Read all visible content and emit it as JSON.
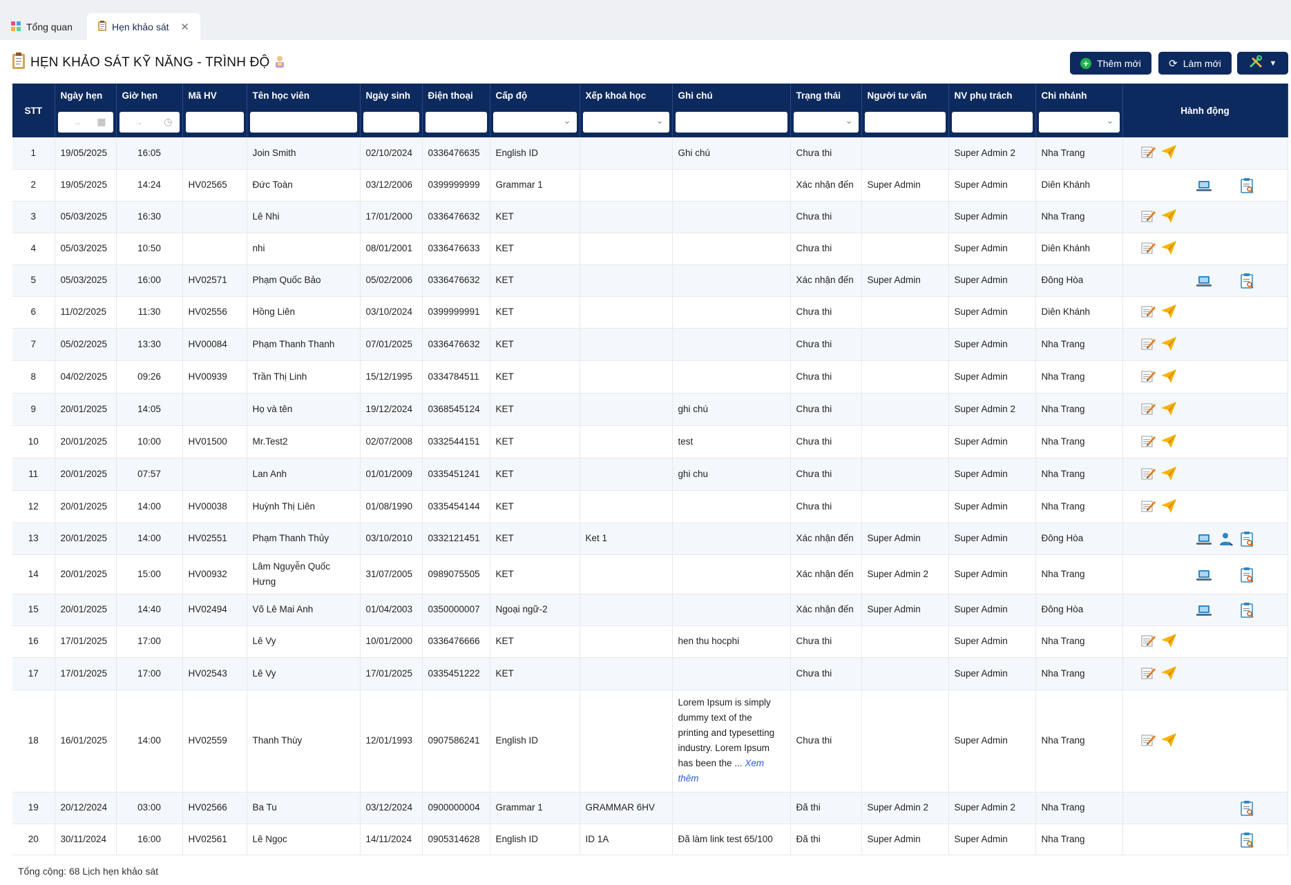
{
  "tabs": [
    {
      "label": "Tổng quan",
      "icon": "dashboard-icon"
    },
    {
      "label": "Hẹn khảo sát",
      "icon": "clipboard-icon",
      "active": true
    }
  ],
  "page": {
    "title": "HẸN KHẢO SÁT KỸ NĂNG - TRÌNH ĐỘ"
  },
  "toolbar": {
    "add_label": "Thêm mới",
    "refresh_label": "Làm mới"
  },
  "columns": [
    "STT",
    "Ngày hẹn",
    "Giờ hẹn",
    "Mã HV",
    "Tên học viên",
    "Ngày sinh",
    "Điện thoại",
    "Cấp độ",
    "Xếp khoá học",
    "Ghi chú",
    "Trạng thái",
    "Người tư vấn",
    "NV phụ trách",
    "Chi nhánh",
    "Hành động"
  ],
  "rows": [
    {
      "stt": "1",
      "date": "19/05/2025",
      "time": "16:05",
      "code": "",
      "name": "Join Smith",
      "dob": "02/10/2024",
      "phone": "0336476635",
      "level": "English ID",
      "course": "",
      "note": "Ghi chú",
      "status": "Chưa thi",
      "advisor": "",
      "staff": "Super Admin 2",
      "branch": "Nha Trang",
      "actions": "edit-send"
    },
    {
      "stt": "2",
      "date": "19/05/2025",
      "time": "14:24",
      "code": "HV02565",
      "name": "Đức Toàn",
      "dob": "03/12/2006",
      "phone": "0399999999",
      "level": "Grammar 1",
      "course": "",
      "note": "",
      "status": "Xác nhận đến",
      "advisor": "Super Admin",
      "staff": "Super Admin",
      "branch": "Diên Khánh",
      "actions": "laptop-report"
    },
    {
      "stt": "3",
      "date": "05/03/2025",
      "time": "16:30",
      "code": "",
      "name": "Lê Nhi",
      "dob": "17/01/2000",
      "phone": "0336476632",
      "level": "KET",
      "course": "",
      "note": "",
      "status": "Chưa thi",
      "advisor": "",
      "staff": "Super Admin",
      "branch": "Nha Trang",
      "actions": "edit-send"
    },
    {
      "stt": "4",
      "date": "05/03/2025",
      "time": "10:50",
      "code": "",
      "name": "nhi",
      "dob": "08/01/2001",
      "phone": "0336476633",
      "level": "KET",
      "course": "",
      "note": "",
      "status": "Chưa thi",
      "advisor": "",
      "staff": "Super Admin",
      "branch": "Diên Khánh",
      "actions": "edit-send"
    },
    {
      "stt": "5",
      "date": "05/03/2025",
      "time": "16:00",
      "code": "HV02571",
      "name": "Phạm Quốc Bảo",
      "dob": "05/02/2006",
      "phone": "0336476632",
      "level": "KET",
      "course": "",
      "note": "",
      "status": "Xác nhận đến",
      "advisor": "Super Admin",
      "staff": "Super Admin",
      "branch": "Đông Hòa",
      "actions": "laptop-report"
    },
    {
      "stt": "6",
      "date": "11/02/2025",
      "time": "11:30",
      "code": "HV02556",
      "name": "Hồng Liên",
      "dob": "03/10/2024",
      "phone": "0399999991",
      "level": "KET",
      "course": "",
      "note": "",
      "status": "Chưa thi",
      "advisor": "",
      "staff": "Super Admin",
      "branch": "Diên Khánh",
      "actions": "edit-send"
    },
    {
      "stt": "7",
      "date": "05/02/2025",
      "time": "13:30",
      "code": "HV00084",
      "name": "Phạm Thanh Thanh",
      "dob": "07/01/2025",
      "phone": "0336476632",
      "level": "KET",
      "course": "",
      "note": "",
      "status": "Chưa thi",
      "advisor": "",
      "staff": "Super Admin",
      "branch": "Nha Trang",
      "actions": "edit-send"
    },
    {
      "stt": "8",
      "date": "04/02/2025",
      "time": "09:26",
      "code": "HV00939",
      "name": "Trần Thị Linh",
      "dob": "15/12/1995",
      "phone": "0334784511",
      "level": "KET",
      "course": "",
      "note": "",
      "status": "Chưa thi",
      "advisor": "",
      "staff": "Super Admin",
      "branch": "Nha Trang",
      "actions": "edit-send"
    },
    {
      "stt": "9",
      "date": "20/01/2025",
      "time": "14:05",
      "code": "",
      "name": "Họ và tên",
      "dob": "19/12/2024",
      "phone": "0368545124",
      "level": "KET",
      "course": "",
      "note": "ghi chú",
      "status": "Chưa thi",
      "advisor": "",
      "staff": "Super Admin 2",
      "branch": "Nha Trang",
      "actions": "edit-send"
    },
    {
      "stt": "10",
      "date": "20/01/2025",
      "time": "10:00",
      "code": "HV01500",
      "name": "Mr.Test2",
      "dob": "02/07/2008",
      "phone": "0332544151",
      "level": "KET",
      "course": "",
      "note": "test",
      "status": "Chưa thi",
      "advisor": "",
      "staff": "Super Admin",
      "branch": "Nha Trang",
      "actions": "edit-send"
    },
    {
      "stt": "11",
      "date": "20/01/2025",
      "time": "07:57",
      "code": "",
      "name": "Lan Anh",
      "dob": "01/01/2009",
      "phone": "0335451241",
      "level": "KET",
      "course": "",
      "note": "ghi chu",
      "status": "Chưa thi",
      "advisor": "",
      "staff": "Super Admin",
      "branch": "Nha Trang",
      "actions": "edit-send"
    },
    {
      "stt": "12",
      "date": "20/01/2025",
      "time": "14:00",
      "code": "HV00038",
      "name": "Huỳnh Thị Liên",
      "dob": "01/08/1990",
      "phone": "0335454144",
      "level": "KET",
      "course": "",
      "note": "",
      "status": "Chưa thi",
      "advisor": "",
      "staff": "Super Admin",
      "branch": "Nha Trang",
      "actions": "edit-send"
    },
    {
      "stt": "13",
      "date": "20/01/2025",
      "time": "14:00",
      "code": "HV02551",
      "name": "Phạm Thanh Thủy",
      "dob": "03/10/2010",
      "phone": "0332121451",
      "level": "KET",
      "course": "Ket 1",
      "note": "",
      "status": "Xác nhận đến",
      "advisor": "Super Admin",
      "staff": "Super Admin",
      "branch": "Đông Hòa",
      "actions": "laptop-user-report"
    },
    {
      "stt": "14",
      "date": "20/01/2025",
      "time": "15:00",
      "code": "HV00932",
      "name": "Lâm Nguyễn Quốc Hưng",
      "dob": "31/07/2005",
      "phone": "0989075505",
      "level": "KET",
      "course": "",
      "note": "",
      "status": "Xác nhận đến",
      "advisor": "Super Admin 2",
      "staff": "Super Admin",
      "branch": "Nha Trang",
      "actions": "laptop-report"
    },
    {
      "stt": "15",
      "date": "20/01/2025",
      "time": "14:40",
      "code": "HV02494",
      "name": "Võ Lê Mai Anh",
      "dob": "01/04/2003",
      "phone": "0350000007",
      "level": "Ngoại ngữ-2",
      "course": "",
      "note": "",
      "status": "Xác nhận đến",
      "advisor": "Super Admin",
      "staff": "Super Admin",
      "branch": "Đông Hòa",
      "actions": "laptop-report"
    },
    {
      "stt": "16",
      "date": "17/01/2025",
      "time": "17:00",
      "code": "",
      "name": "Lê Vy",
      "dob": "10/01/2000",
      "phone": "0336476666",
      "level": "KET",
      "course": "",
      "note": "hen thu hocphi",
      "status": "Chưa thi",
      "advisor": "",
      "staff": "Super Admin",
      "branch": "Nha Trang",
      "actions": "edit-send"
    },
    {
      "stt": "17",
      "date": "17/01/2025",
      "time": "17:00",
      "code": "HV02543",
      "name": "Lê Vy",
      "dob": "17/01/2025",
      "phone": "0335451222",
      "level": "KET",
      "course": "",
      "note": "",
      "status": "Chưa thi",
      "advisor": "",
      "staff": "Super Admin",
      "branch": "Nha Trang",
      "actions": "edit-send"
    },
    {
      "stt": "18",
      "date": "16/01/2025",
      "time": "14:00",
      "code": "HV02559",
      "name": "Thanh Thùy",
      "dob": "12/01/1993",
      "phone": "0907586241",
      "level": "English ID",
      "course": "",
      "note": "Lorem Ipsum is simply dummy text of the printing and typesetting industry. Lorem Ipsum has been the ...",
      "note_more": "Xem thêm",
      "status": "Chưa thi",
      "advisor": "",
      "staff": "Super Admin",
      "branch": "Nha Trang",
      "actions": "edit-send"
    },
    {
      "stt": "19",
      "date": "20/12/2024",
      "time": "03:00",
      "code": "HV02566",
      "name": "Ba Tu",
      "dob": "03/12/2024",
      "phone": "0900000004",
      "level": "Grammar 1",
      "course": "GRAMMAR 6HV",
      "note": "",
      "status": "Đã thi",
      "advisor": "Super Admin 2",
      "staff": "Super Admin 2",
      "branch": "Nha Trang",
      "actions": "report"
    },
    {
      "stt": "20",
      "date": "30/11/2024",
      "time": "16:00",
      "code": "HV02561",
      "name": "Lê Ngọc",
      "dob": "14/11/2024",
      "phone": "0905314628",
      "level": "English ID",
      "course": "ID 1A",
      "note": "Đã làm link test 65/100",
      "status": "Đã thi",
      "advisor": "Super Admin",
      "staff": "Super Admin",
      "branch": "Nha Trang",
      "actions": "report"
    }
  ],
  "footer": {
    "total": "Tổng cộng: 68 Lịch hẹn khảo sát"
  }
}
